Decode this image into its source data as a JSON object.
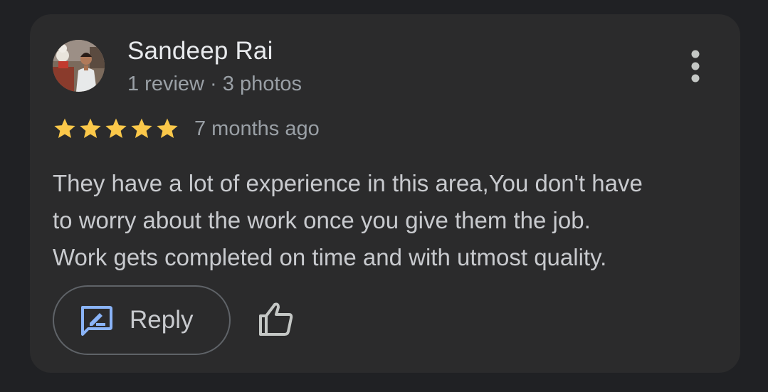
{
  "review": {
    "author": "Sandeep Rai",
    "meta": "1 review · 3 photos",
    "rating": 5,
    "time": "7 months ago",
    "text_lines": [
      "They have a lot of experience in this area,You don't have",
      "to worry about the work once you give them the job.",
      "Work gets completed on time and with utmost quality."
    ]
  },
  "actions": {
    "reply_label": "Reply",
    "reply_icon": "rate-review-icon",
    "like_icon": "thumb-up-icon",
    "more_icon": "more-vert-icon"
  },
  "colors": {
    "background": "#202124",
    "card": "#2b2b2c",
    "star": "#fbc84a",
    "reply_icon": "#8ab4f8",
    "text_primary": "#e8eaed",
    "text_secondary": "#9aa0a6"
  }
}
